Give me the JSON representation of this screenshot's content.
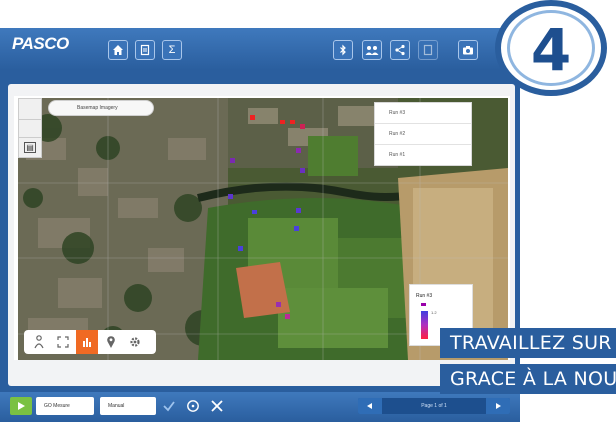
{
  "app": {
    "logo": "PASCO"
  },
  "toolbar_left": [
    {
      "name": "home-icon"
    },
    {
      "name": "file-icon"
    },
    {
      "name": "sigma-icon",
      "label": "Σ"
    }
  ],
  "toolbar_right": [
    {
      "name": "bluetooth-icon"
    },
    {
      "name": "people-icon"
    },
    {
      "name": "share-icon"
    },
    {
      "name": "document-icon"
    },
    {
      "name": "camera-icon"
    }
  ],
  "map": {
    "dropdown_label": "Basemap Imagery",
    "legend_items": [
      "Run #3",
      "Run #2",
      "Run #1"
    ],
    "scale_title": "Run #3",
    "scale_label": "1.2",
    "tools": [
      {
        "name": "person-icon",
        "label": "⚲"
      },
      {
        "name": "expand-icon",
        "label": "⤢"
      },
      {
        "name": "chart-icon",
        "label": "▮"
      },
      {
        "name": "pin-icon",
        "label": "⚲"
      },
      {
        "name": "gear-icon",
        "label": "✿"
      }
    ]
  },
  "bottombar": {
    "sampling_label": "GO Mesure",
    "mode_label": "Manual",
    "nav_label": "Page 1 of 1"
  },
  "badge": {
    "number": "4"
  },
  "banner": {
    "line1": "TRAVAILLEZ SUR",
    "line2": "GRACE À LA NOU"
  },
  "colors": {
    "pasco_blue": "#2a5e9e",
    "active_tool": "#f06a23",
    "play_green": "#7ac143"
  }
}
